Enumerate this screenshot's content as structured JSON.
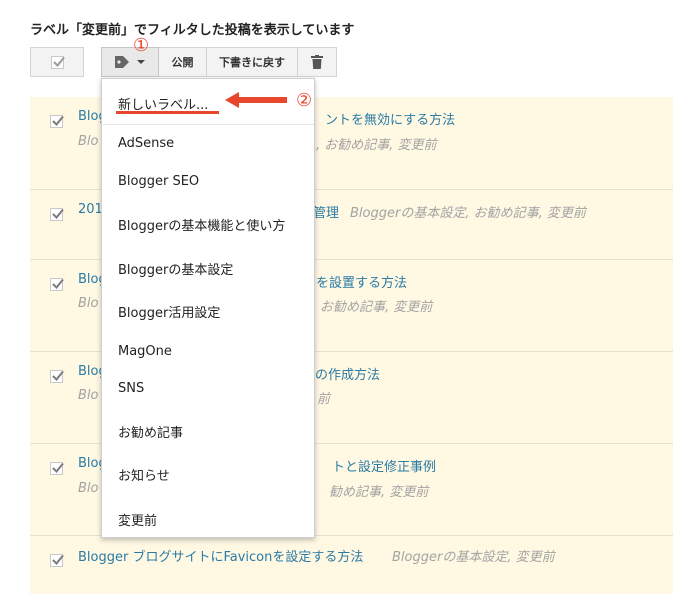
{
  "header": {
    "filter_text": "ラベル「変更前」でフィルタした投稿を表示しています"
  },
  "toolbar": {
    "publish_label": "公開",
    "draft_label": "下書きに戻す"
  },
  "markers": {
    "one": "①",
    "two": "②"
  },
  "posts": [
    {
      "title": "Blogger ブログでコメントを無効にする方法",
      "visible_title_start": "Blog",
      "visible_title_end": "ントを無効にする方法",
      "labels_visible_start": "Blo",
      "labels_visible_end": ", お勧め記事, 変更前"
    },
    {
      "title_start": "201",
      "title_end": "管理",
      "labels_visible": "Bloggerの基本設定, お勧め記事, 変更前"
    },
    {
      "title_start": "Blog",
      "title_end": "を設置する方法",
      "labels_start": "Blo",
      "labels_end": "お勧め記事, 変更前"
    },
    {
      "title_start": "Blog",
      "title_end": "の作成方法",
      "labels_start": "Blo",
      "labels_end": "前"
    },
    {
      "title_start": "Blog",
      "title_end": "トと設定修正事例",
      "labels_start": "Blo",
      "labels_end": "勧め記事, 変更前"
    },
    {
      "title": "Blogger ブログサイトにFaviconを設定する方法",
      "labels": "Bloggerの基本設定, 変更前"
    }
  ],
  "label_menu": {
    "new_label": "新しいラベル...",
    "items": [
      "AdSense",
      "Blogger SEO",
      "Bloggerの基本機能と使い方",
      "Bloggerの基本設定",
      "Blogger活用設定",
      "MagOne",
      "SNS",
      "お勧め記事",
      "お知らせ",
      "変更前"
    ]
  },
  "colors": {
    "accent": "#e8472b",
    "link": "#2a7ba6",
    "row_bg": "#fff8e3"
  }
}
